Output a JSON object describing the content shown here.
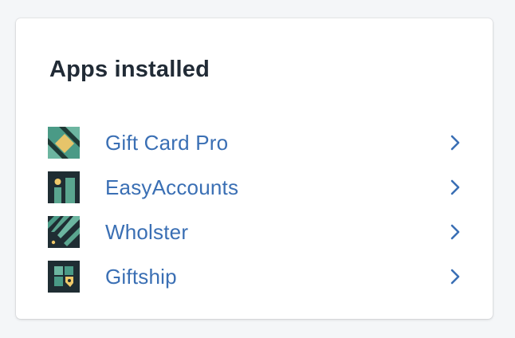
{
  "card": {
    "title": "Apps installed"
  },
  "apps": [
    {
      "name": "Gift Card Pro",
      "icon": "gift-card-pro-icon"
    },
    {
      "name": "EasyAccounts",
      "icon": "easyaccounts-icon"
    },
    {
      "name": "Wholster",
      "icon": "wholster-icon"
    },
    {
      "name": "Giftship",
      "icon": "giftship-icon"
    }
  ],
  "colors": {
    "link": "#3a6fb4",
    "title": "#212b36",
    "icon_dark": "#1f2d33",
    "icon_green": "#4a9a86",
    "icon_yellow": "#f0c96a"
  }
}
